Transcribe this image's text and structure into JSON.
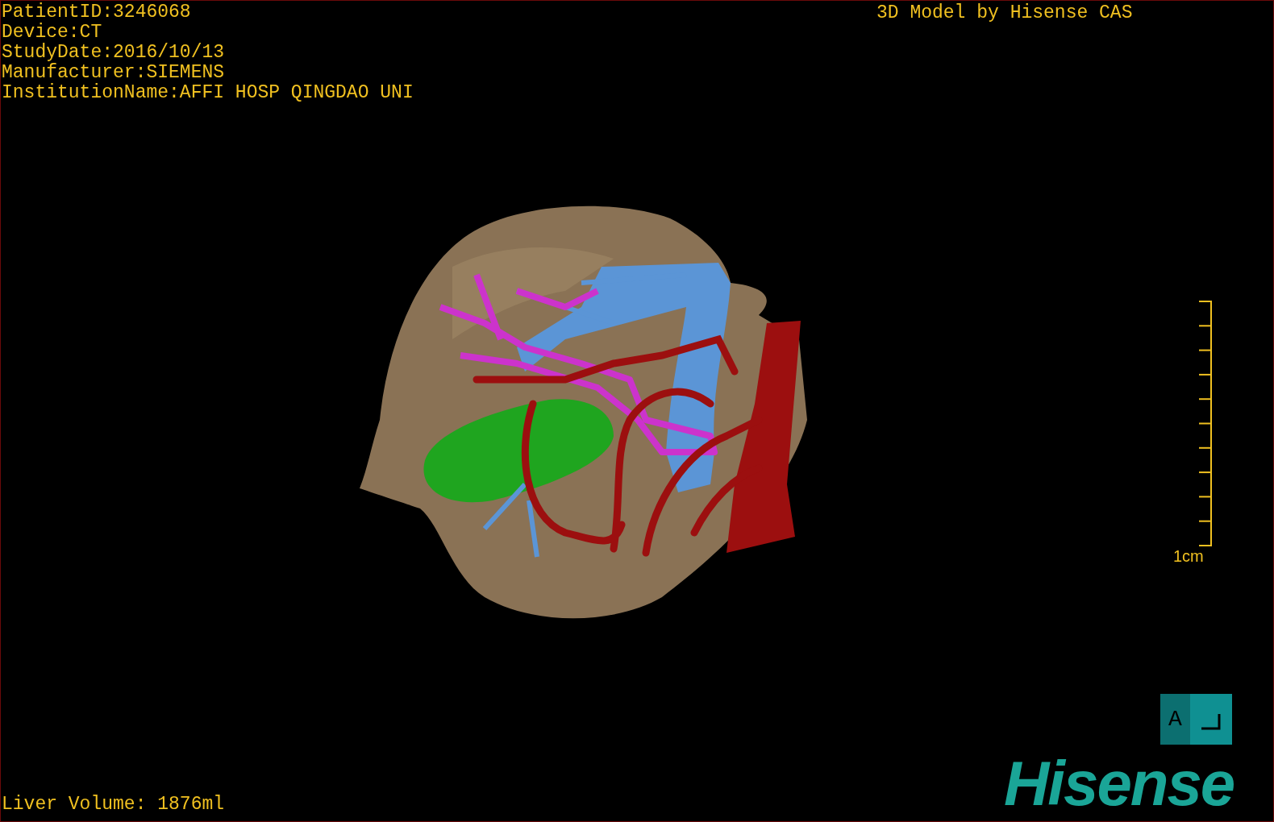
{
  "patient_info": [
    "PatientID:3246068",
    "Device:CT",
    "StudyDate:2016/10/13",
    "Manufacturer:SIEMENS",
    "InstitutionName:AFFI HOSP QINGDAO UNI"
  ],
  "model_credit": "3D Model by Hisense CAS",
  "scale_bar": {
    "label": "1cm"
  },
  "orientation_cube": {
    "label": "A"
  },
  "liver_volume": "Liver Volume: 1876ml",
  "logo": "Hisense"
}
